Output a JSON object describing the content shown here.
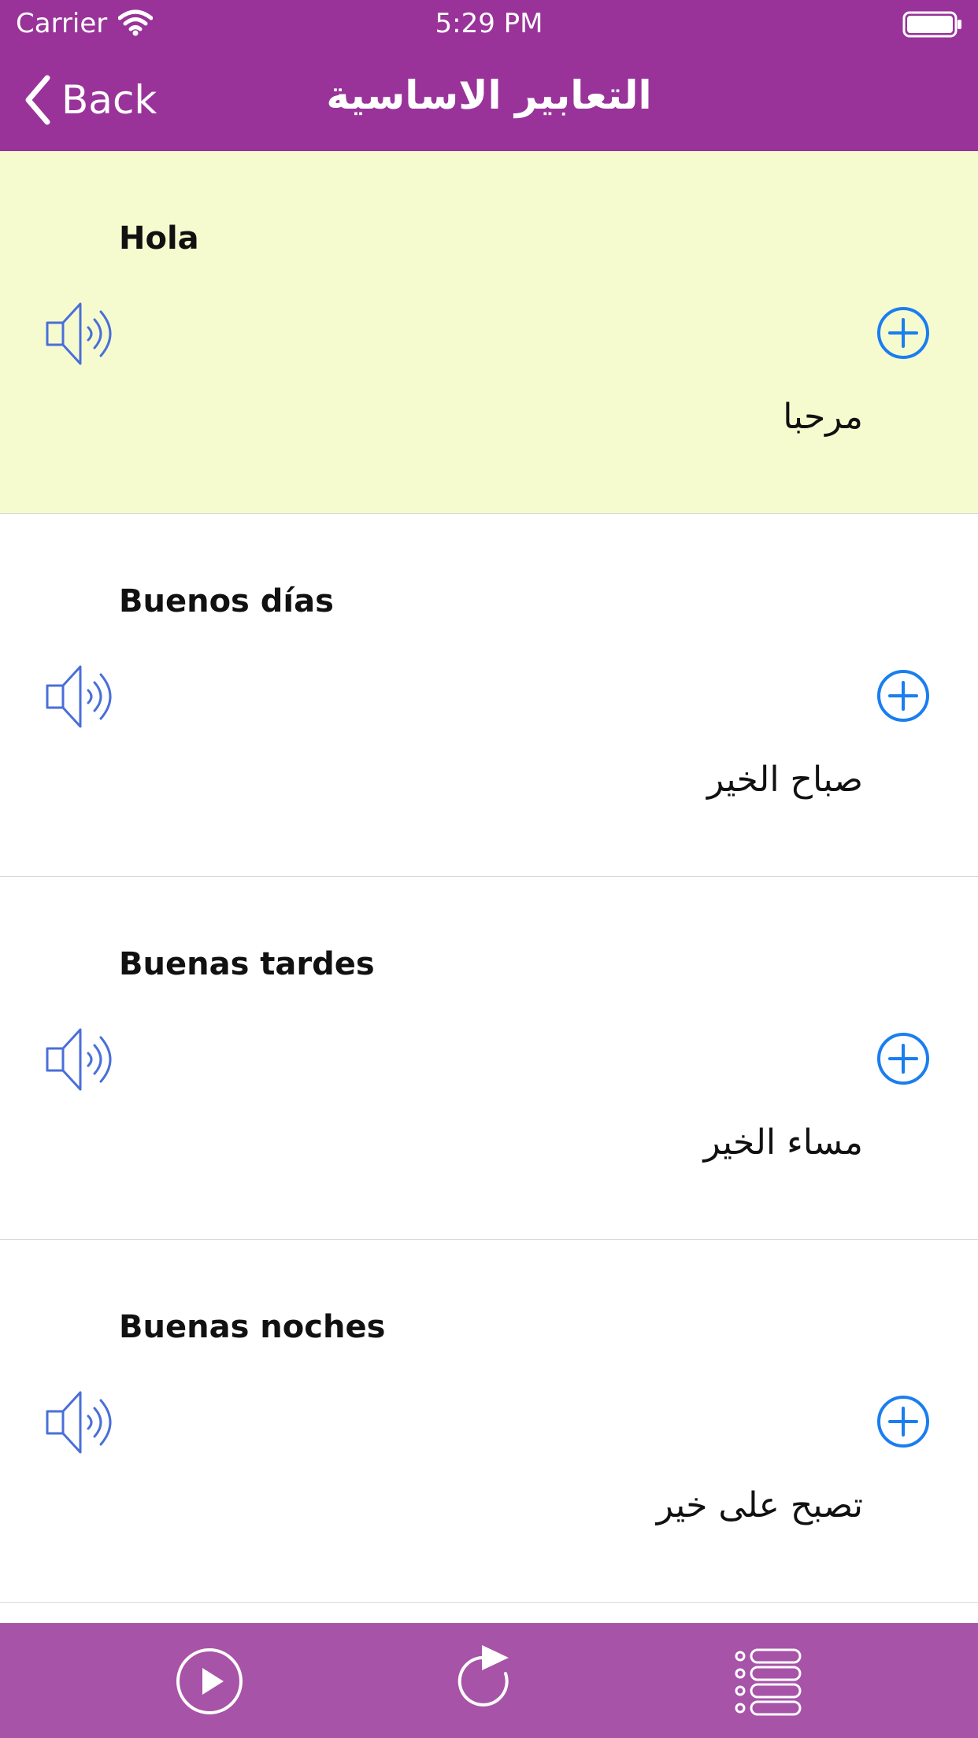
{
  "status_bar": {
    "carrier": "Carrier",
    "time": "5:29 PM"
  },
  "nav": {
    "back_label": "Back",
    "title": "التعابير الاساسية"
  },
  "phrases": [
    {
      "spanish": "Hola",
      "arabic": "مرحبا",
      "highlighted": true
    },
    {
      "spanish": "Buenos días",
      "arabic": "صباح الخير",
      "highlighted": false
    },
    {
      "spanish": "Buenas tardes",
      "arabic": "مساء الخير",
      "highlighted": false
    },
    {
      "spanish": "Buenas noches",
      "arabic": "تصبح على خير",
      "highlighted": false
    }
  ],
  "toolbar": {
    "items": [
      {
        "icon": "play-icon"
      },
      {
        "icon": "repeat-icon"
      },
      {
        "icon": "list-icon"
      }
    ]
  },
  "colors": {
    "nav_background": "#993399",
    "toolbar_background": "#a753a8",
    "highlight_row": "#f6fbcf",
    "speaker_blue": "#4a6fd8",
    "add_blue": "#1a7ef0"
  }
}
